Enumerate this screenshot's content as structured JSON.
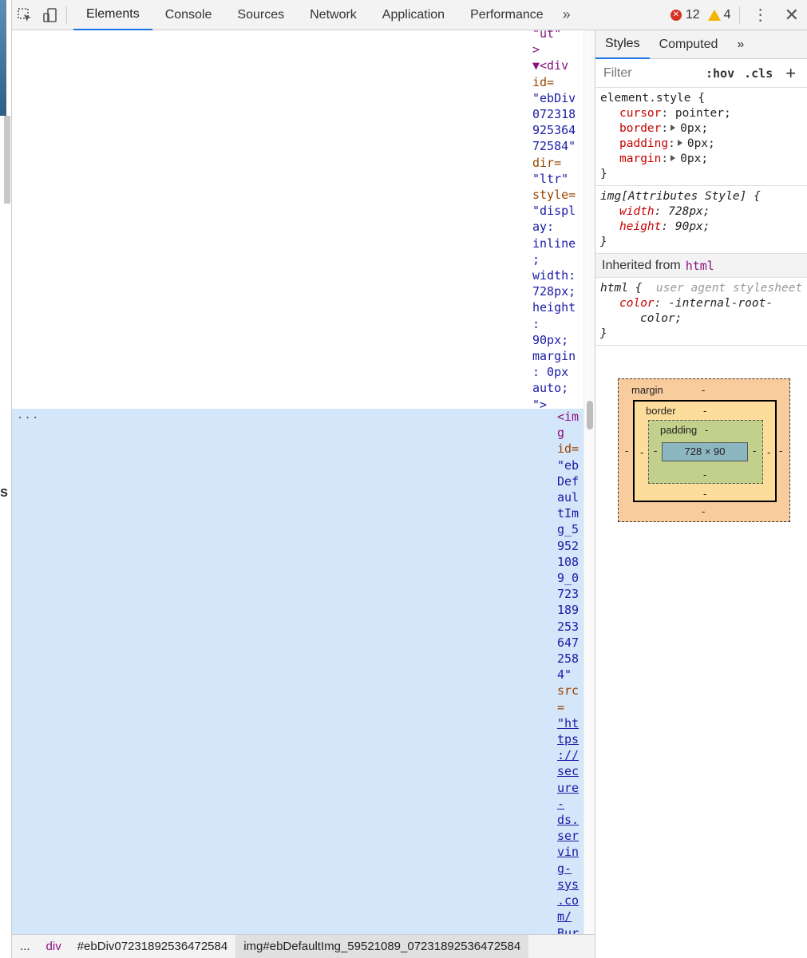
{
  "toolbar": {
    "tabs": [
      "Elements",
      "Console",
      "Sources",
      "Network",
      "Application",
      "Performance"
    ],
    "more": "»",
    "errors": "12",
    "warnings": "4"
  },
  "dom": {
    "code_top": [
      {
        "t": "tg",
        "s": "\"ut\""
      },
      {
        "t": "tg",
        "s": ">"
      },
      {
        "t": "tg",
        "s": "▼<div"
      },
      {
        "t": "an",
        "s": "id="
      },
      {
        "t": "av",
        "s": "\"ebDiv"
      },
      {
        "t": "av",
        "s": "072318"
      },
      {
        "t": "av",
        "s": "925364"
      },
      {
        "t": "av",
        "s": "72584\""
      },
      {
        "t": "an",
        "s": "dir="
      },
      {
        "t": "av",
        "s": "\"ltr\""
      },
      {
        "t": "an",
        "s": "style="
      },
      {
        "t": "av",
        "s": "\"displ"
      },
      {
        "t": "av",
        "s": "ay:"
      },
      {
        "t": "av",
        "s": "inline"
      },
      {
        "t": "av",
        "s": ";"
      },
      {
        "t": "av",
        "s": "width:"
      },
      {
        "t": "av",
        "s": "728px;"
      },
      {
        "t": "av",
        "s": "height"
      },
      {
        "t": "av",
        "s": ":"
      },
      {
        "t": "av",
        "s": "90px;"
      },
      {
        "t": "av",
        "s": "margin"
      },
      {
        "t": "av",
        "s": ": 0px"
      },
      {
        "t": "av",
        "s": "auto;"
      },
      {
        "t": "av",
        "s": "\">"
      }
    ],
    "code_sel": [
      {
        "t": "tg",
        "s": "<im"
      },
      {
        "t": "tg",
        "s": "g"
      },
      {
        "t": "an",
        "s": "id="
      },
      {
        "t": "av",
        "s": "\"eb"
      },
      {
        "t": "av",
        "s": "Def"
      },
      {
        "t": "av",
        "s": "aul"
      },
      {
        "t": "av",
        "s": "tIm"
      },
      {
        "t": "av",
        "s": "g_5"
      },
      {
        "t": "av",
        "s": "952"
      },
      {
        "t": "av",
        "s": "108"
      },
      {
        "t": "av",
        "s": "9_0"
      },
      {
        "t": "av",
        "s": "723"
      },
      {
        "t": "av",
        "s": "189"
      },
      {
        "t": "av",
        "s": "253"
      },
      {
        "t": "av",
        "s": "647"
      },
      {
        "t": "av",
        "s": "258"
      },
      {
        "t": "av",
        "s": "4\""
      },
      {
        "t": "an",
        "s": "src"
      },
      {
        "t": "an",
        "s": "="
      },
      {
        "t": "lk",
        "s": "\"ht"
      },
      {
        "t": "lk",
        "s": "tps"
      },
      {
        "t": "lk",
        "s": "://"
      },
      {
        "t": "lk",
        "s": "sec"
      },
      {
        "t": "lk",
        "s": "ure"
      },
      {
        "t": "lk",
        "s": "-"
      },
      {
        "t": "lk",
        "s": "ds."
      },
      {
        "t": "lk",
        "s": "ser"
      },
      {
        "t": "lk",
        "s": "vin"
      },
      {
        "t": "lk",
        "s": "g-"
      },
      {
        "t": "lk",
        "s": "sys"
      },
      {
        "t": "lk",
        "s": ".co"
      },
      {
        "t": "lk",
        "s": "m/"
      },
      {
        "t": "lk",
        "s": "Bur"
      }
    ],
    "dots": "..."
  },
  "breadcrumb": {
    "ellipsis": "...",
    "items": [
      "div",
      "#ebDiv07231892536472584",
      "img#ebDefaultImg_59521089_07231892536472584"
    ]
  },
  "styles": {
    "tabs": [
      "Styles",
      "Computed"
    ],
    "more": "»",
    "filter_placeholder": "Filter",
    "hov": ":hov",
    "cls": ".cls",
    "plus": "+",
    "element_style": {
      "selector": "element.style {",
      "props": [
        {
          "name": "cursor",
          "value": "pointer;",
          "arrow": false
        },
        {
          "name": "border",
          "value": "0px;",
          "arrow": true
        },
        {
          "name": "padding",
          "value": "0px;",
          "arrow": true
        },
        {
          "name": "margin",
          "value": "0px;",
          "arrow": true
        }
      ],
      "close": "}"
    },
    "attr_style": {
      "selector": "img[Attributes Style] {",
      "props": [
        {
          "name": "width",
          "value": "728px;"
        },
        {
          "name": "height",
          "value": "90px;"
        }
      ],
      "close": "}"
    },
    "inherited": {
      "label": "Inherited from",
      "tag": "html"
    },
    "ua_rule": {
      "selector": "html {",
      "source": "user agent stylesheet",
      "prop": "color",
      "value_1": "-internal-root-",
      "value_2": "color;",
      "close": "}"
    }
  },
  "box_model": {
    "margin_label": "margin",
    "border_label": "border",
    "padding_label": "padding",
    "content": "728 × 90",
    "dash": "-"
  }
}
